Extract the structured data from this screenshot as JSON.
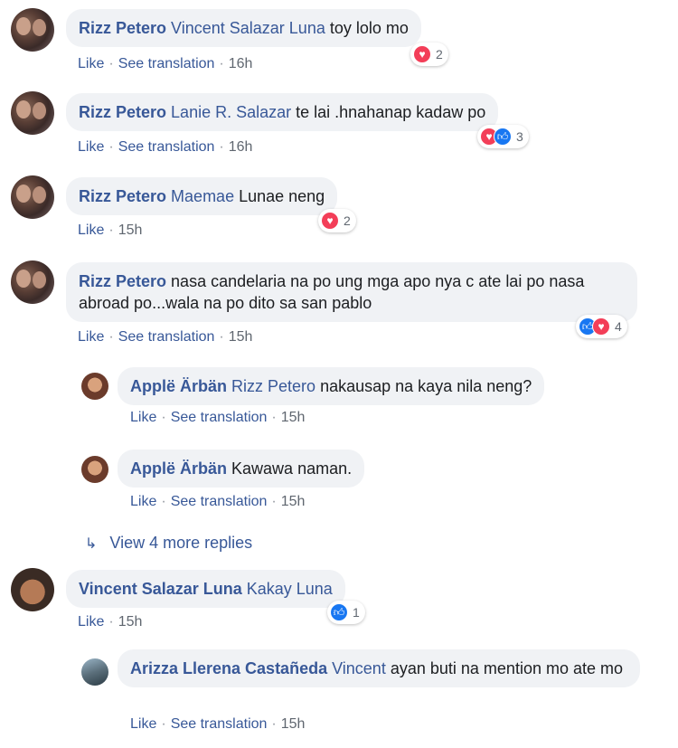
{
  "comments": [
    {
      "author": "Rizz Petero",
      "mention": "Vincent Salazar Luna",
      "text": "toy lolo mo",
      "like": "Like",
      "translate": "See translation",
      "time": "16h",
      "reactions": [
        "heart"
      ],
      "count": "2"
    },
    {
      "author": "Rizz Petero",
      "mention": "Lanie R. Salazar",
      "text": "te lai .hnahanap kadaw po",
      "like": "Like",
      "translate": "See translation",
      "time": "16h",
      "reactions": [
        "heart",
        "like"
      ],
      "count": "3"
    },
    {
      "author": "Rizz Petero",
      "mention": "Maemae",
      "text": "Lunae neng",
      "like": "Like",
      "time": "15h",
      "reactions": [
        "heart"
      ],
      "count": "2"
    },
    {
      "author": "Rizz Petero",
      "text": "nasa candelaria na po ung mga apo nya c ate lai po nasa abroad po...wala na po dito sa san pablo",
      "like": "Like",
      "translate": "See translation",
      "time": "15h",
      "reactions": [
        "like",
        "heart"
      ],
      "count": "4",
      "replies": [
        {
          "author": "Applë Ärbän",
          "mention": "Rizz Petero",
          "text": "nakausap na kaya nila neng?",
          "like": "Like",
          "translate": "See translation",
          "time": "15h"
        },
        {
          "author": "Applë Ärbän",
          "text": "Kawawa naman.",
          "like": "Like",
          "translate": "See translation",
          "time": "15h"
        }
      ],
      "more_replies": "View 4 more replies"
    },
    {
      "author": "Vincent Salazar Luna",
      "mention": "Kakay Luna",
      "like": "Like",
      "time": "15h",
      "reactions": [
        "like"
      ],
      "count": "1",
      "replies": [
        {
          "author": "Arizza Llerena Castañeda",
          "mention": "Vincent",
          "text": "ayan buti na mention mo ate mo",
          "like": "Like",
          "translate": "See translation",
          "time": "15h"
        }
      ]
    }
  ],
  "colors": {
    "name": "#385898",
    "bubble": "#f0f2f5",
    "heart": "#f33e58",
    "like": "#1877f2"
  },
  "icons": {
    "heart": "heart-reaction-icon",
    "like": "like-reaction-icon",
    "reply_arrow": "reply-arrow-icon"
  }
}
